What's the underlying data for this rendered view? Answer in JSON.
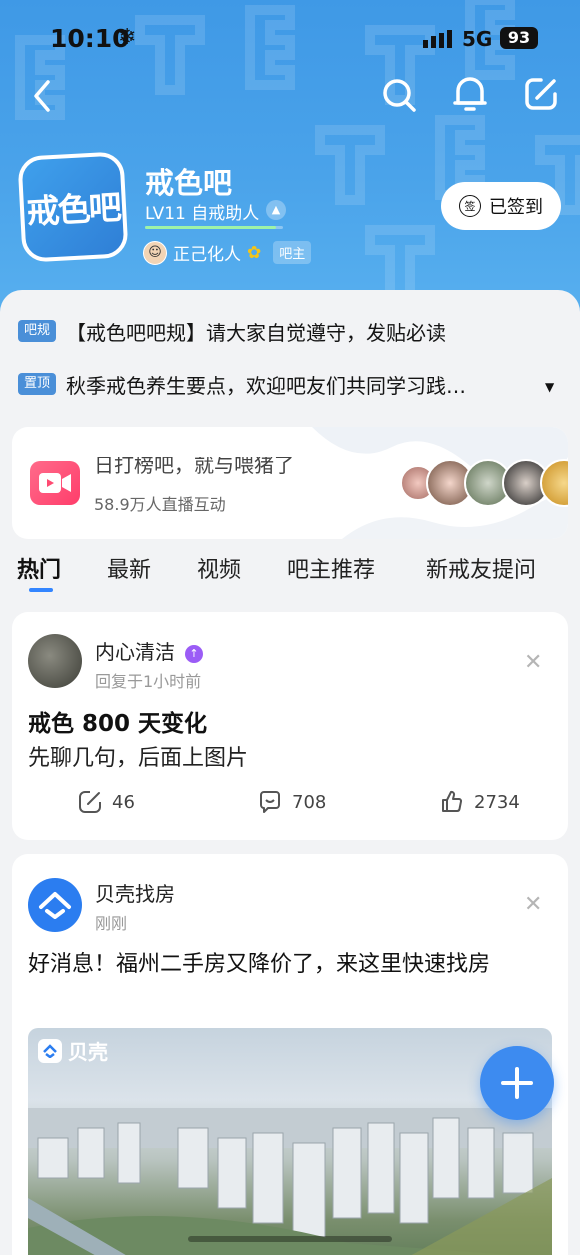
{
  "status_bar": {
    "time": "10:10",
    "network": "5G",
    "battery": "93"
  },
  "forum": {
    "avatar_text": "戒色吧",
    "name": "戒色吧",
    "level": "LV11 自戒助人",
    "level_progress": 0.95,
    "owner_name": "正己化人",
    "owner_badge": "吧主",
    "checkin_label": "已签到",
    "checkin_icon_text": "签"
  },
  "notices": [
    {
      "tag": "吧规",
      "text": "【戒色吧吧规】请大家自觉遵守，发贴必读"
    },
    {
      "tag": "置顶",
      "text": "秋季戒色养生要点，欢迎吧友们共同学习践…"
    }
  ],
  "live": {
    "title": "日打榜吧，就与喂猪了",
    "subtitle": "58.9万人直播互动"
  },
  "tabs": [
    "热门",
    "最新",
    "视频",
    "吧主推荐",
    "新戒友提问"
  ],
  "post": {
    "author": "内心清洁",
    "meta": "回复于1小时前",
    "title": "戒色 800 天变化",
    "body": "先聊几句，后面上图片",
    "shares": "46",
    "comments": "708",
    "likes": "2734"
  },
  "ad": {
    "author": "贝壳找房",
    "meta": "刚刚",
    "text": "好消息！福州二手房又降价了，来这里快速找房",
    "brand": "贝壳"
  },
  "colors": {
    "accent": "#3385ff",
    "header": "#4aa3ea",
    "tag": "#4a8fd8"
  }
}
